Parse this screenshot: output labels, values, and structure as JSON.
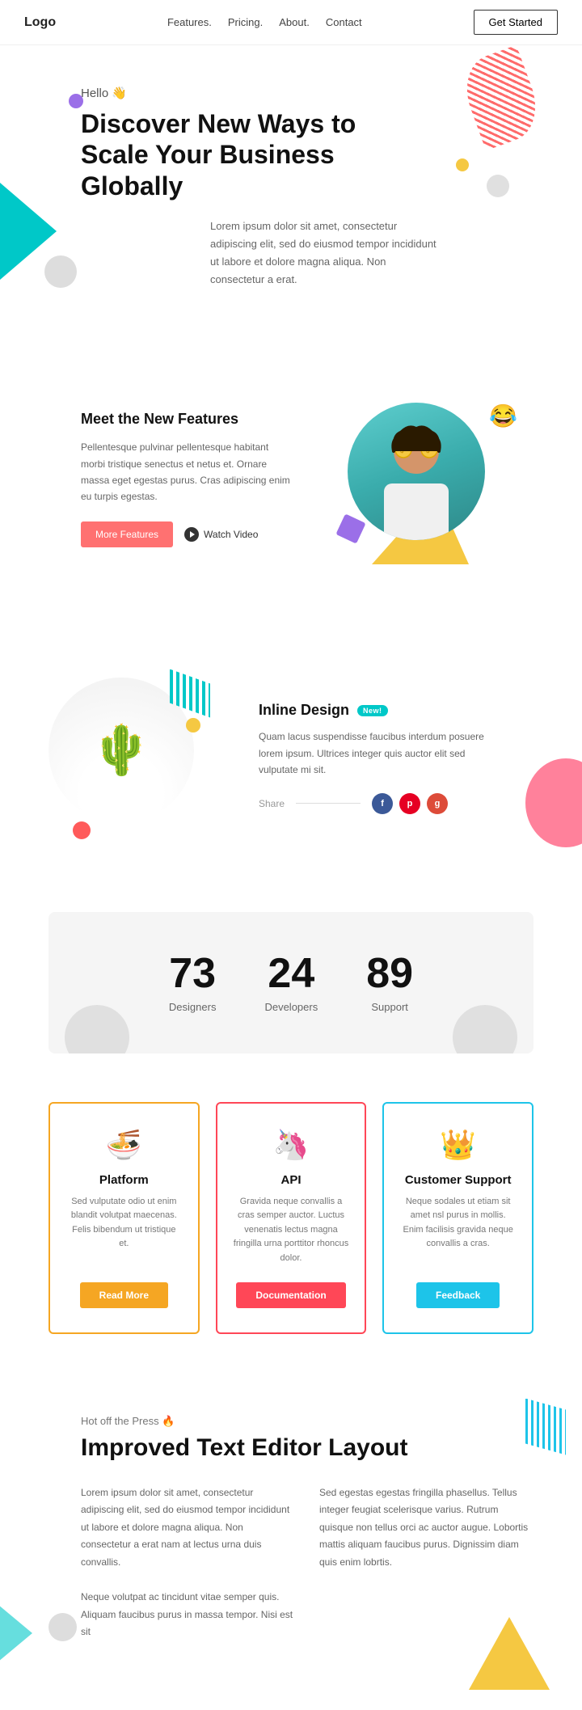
{
  "nav": {
    "logo": "Logo",
    "links": [
      {
        "label": "Features",
        "id": "features"
      },
      {
        "label": "Pricing",
        "id": "pricing"
      },
      {
        "label": "About",
        "id": "about"
      },
      {
        "label": "Contact",
        "id": "contact"
      }
    ],
    "cta": "Get Started"
  },
  "hero": {
    "greeting": "Hello 👋",
    "title": "Discover New Ways to Scale Your Business Globally",
    "description": "Lorem ipsum dolor sit amet, consectetur adipiscing elit, sed do eiusmod tempor incididunt ut labore et dolore magna aliqua. Non consectetur a erat."
  },
  "features": {
    "title": "Meet the New Features",
    "description": "Pellentesque pulvinar pellentesque habitant morbi tristique senectus et netus et. Ornare massa eget egestas purus. Cras adipiscing enim eu turpis egestas.",
    "btn_more": "More Features",
    "btn_watch": "Watch Video"
  },
  "inline": {
    "title": "Inline Design",
    "badge": "New!",
    "description": "Quam lacus suspendisse faucibus interdum posuere lorem ipsum. Ultrices integer quis auctor elit sed vulputate mi sit.",
    "share_label": "Share",
    "social": [
      {
        "name": "facebook",
        "class": "si-fb",
        "symbol": "f"
      },
      {
        "name": "pinterest",
        "class": "si-pin",
        "symbol": "p"
      },
      {
        "name": "google",
        "class": "si-g",
        "symbol": "g"
      }
    ]
  },
  "stats": [
    {
      "number": "73",
      "label": "Designers"
    },
    {
      "number": "24",
      "label": "Developers"
    },
    {
      "number": "89",
      "label": "Support"
    }
  ],
  "cards": [
    {
      "id": "platform",
      "emoji": "🍜",
      "title": "Platform",
      "description": "Sed vulputate odio ut enim blandit volutpat maecenas. Felis bibendum ut tristique et.",
      "btn_label": "Read More",
      "btn_class": "btn-orange",
      "border_class": "card-orange"
    },
    {
      "id": "api",
      "emoji": "🦄",
      "title": "API",
      "description": "Gravida neque convallis a cras semper auctor. Luctus venenatis lectus magna fringilla urna porttitor rhoncus dolor.",
      "btn_label": "Documentation",
      "btn_class": "btn-red",
      "border_class": "card-red"
    },
    {
      "id": "customer-support",
      "emoji": "👑",
      "title": "Customer Support",
      "description": "Neque sodales ut etiam sit amet nsl purus in mollis. Enim facilisis gravida neque convallis a cras.",
      "btn_label": "Feedback",
      "btn_class": "btn-blue",
      "border_class": "card-blue"
    }
  ],
  "blog": {
    "tag": "Hot off the Press 🔥",
    "title": "Improved Text Editor Layout",
    "col1": "Lorem ipsum dolor sit amet, consectetur adipiscing elit, sed do eiusmod tempor incididunt ut labore et dolore magna aliqua. Non consectetur a erat nam at lectus urna duis convallis.\n\nNeque volutpat ac tincidunt vitae semper quis. Aliquam faucibus purus in massa tempor. Nisi est sit",
    "col2": "Sed egestas egestas fringilla phasellus. Tellus integer feugiat scelerisque varius. Rutrum quisque non tellus orci ac auctor augue. Lobortis mattis aliquam faucibus purus. Dignissim diam quis enim lobrtis."
  }
}
